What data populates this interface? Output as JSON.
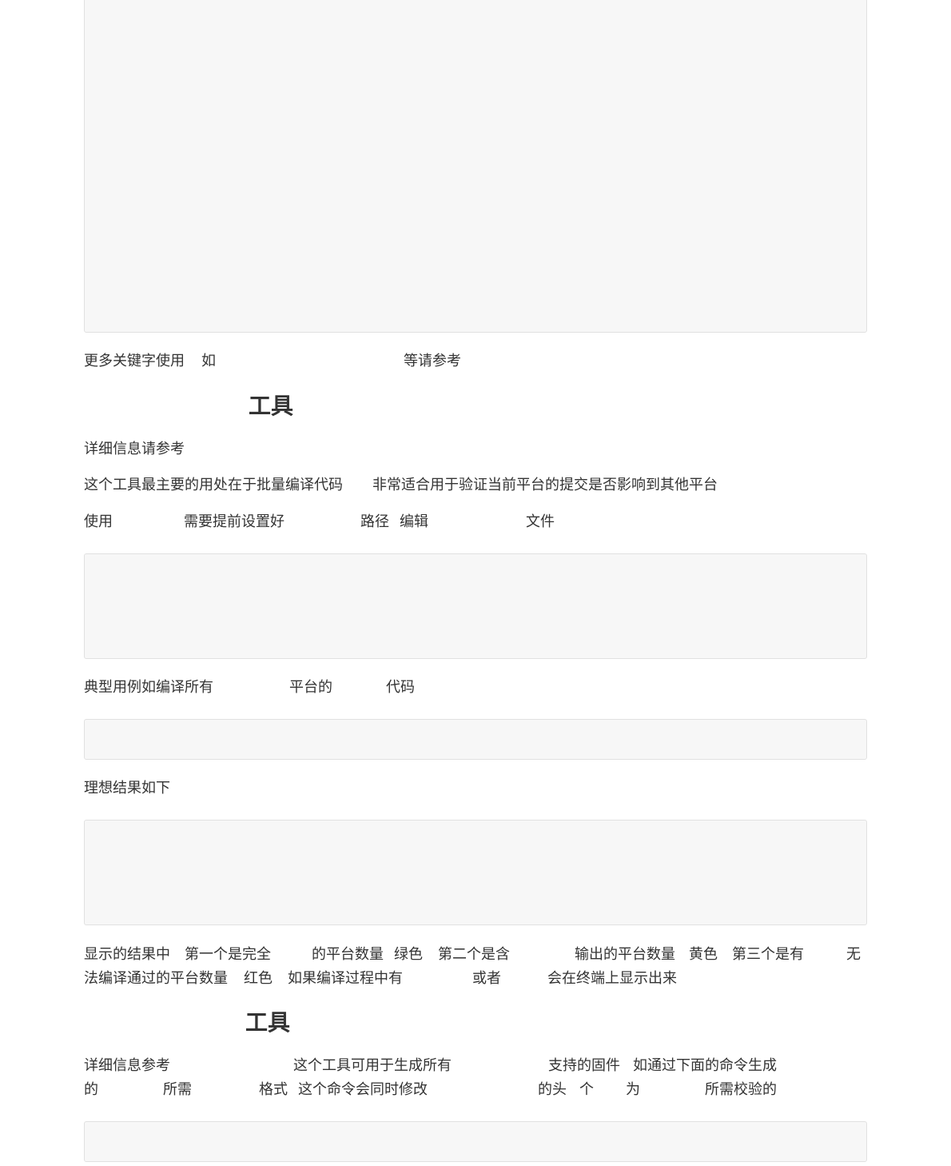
{
  "line1": {
    "t1": "更多关键字使用",
    "t2": "如",
    "t3": "等请参考"
  },
  "heading1": "工具",
  "line2": "详细信息请参考",
  "line3": {
    "t1": "这个工具最主要的用处在于批量编译代码",
    "t2": "非常适合用于验证当前平台的提交是否影响到其他平台"
  },
  "line4": {
    "t1": "使用",
    "t2": "需要提前设置好",
    "t3": "路径",
    "t4": "编辑",
    "t5": "文件"
  },
  "line5": {
    "t1": "典型用例如编译所有",
    "t2": "平台的",
    "t3": "代码"
  },
  "line6": "理想结果如下",
  "para1": {
    "a1": "显示的结果中",
    "a2": "第一个是完全",
    "a3": "的平台数量",
    "a4": "绿色",
    "a5": "第二个是含",
    "a6": "输出的平台数量",
    "a7": "黄色",
    "a8": "第三个是有",
    "a9": "无",
    "b1": "法编译通过的平台数量",
    "b2": "红色",
    "b3": "如果编译过程中有",
    "b4": "或者",
    "b5": "会在终端上显示出来"
  },
  "heading2": "工具",
  "para2": {
    "a1": "详细信息参考",
    "a2": "这个工具可用于生成所有",
    "a3": "支持的固件",
    "a4": "如通过下面的命令生成",
    "b1": "的",
    "b2": "所需",
    "b3": "格式",
    "b4": "这个命令会同时修改",
    "b5": "的头",
    "b6": "个",
    "b7": "为",
    "b8": "所需校验的"
  }
}
